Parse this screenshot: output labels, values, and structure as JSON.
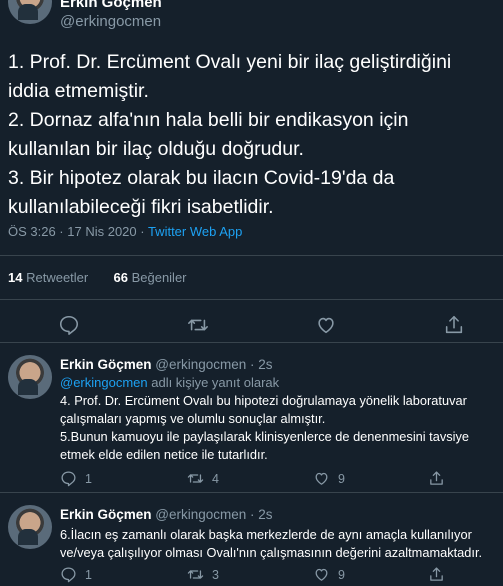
{
  "main_tweet": {
    "author_name": "Erkin Göçmen",
    "author_handle": "@erkingocmen",
    "text_lines": [
      "1. Prof. Dr. Ercüment Ovalı yeni bir ilaç geliştirdiğini iddia etmemiştir.",
      "2. Dornaz alfa'nın hala belli bir endikasyon için kullanılan bir ilaç olduğu doğrudur.",
      "3. Bir hipotez olarak bu ilacın Covid-19'da da kullanılabileceği fikri isabetlidir."
    ],
    "timestamp": "ÖS 3:26 · 17 Nis 2020 · ",
    "source": "Twitter Web App",
    "retweet_count": "14",
    "retweet_label": "Retweetler",
    "like_count": "66",
    "like_label": "Beğeniler"
  },
  "replies": [
    {
      "author_name": "Erkin Göçmen",
      "author_handle": "@erkingocmen · 2s",
      "reply_to_handle": "@erkingocmen",
      "reply_to_suffix": " adlı kişiye yanıt olarak",
      "text_lines": [
        "4. Prof. Dr. Ercüment Ovalı bu hipotezi doğrulamaya yönelik laboratuvar çalışmaları yapmış ve olumlu sonuçlar almıştır.",
        "5.Bunun kamuoyu ile paylaşılarak klinisyenlerce de denenmesini tavsiye etmek elde edilen netice ile tutarlıdır."
      ],
      "reply_count": "1",
      "retweet_count": "4",
      "like_count": "9"
    },
    {
      "author_name": "Erkin Göçmen",
      "author_handle": "@erkingocmen · 2s",
      "text_lines": [
        "6.İlacın eş zamanlı olarak başka merkezlerde de aynı amaçla kullanılıyor ve/veya çalışılıyor olması Ovalı'nın çalışmasının değerini azaltmamaktadır."
      ],
      "reply_count": "1",
      "retweet_count": "3",
      "like_count": "9"
    }
  ],
  "icons": {
    "reply": "reply-icon",
    "retweet": "retweet-icon",
    "like": "heart-icon",
    "share": "share-icon"
  },
  "colors": {
    "background": "#15202b",
    "accent": "#1da1f2",
    "muted": "#8899a6",
    "divider": "#38444d"
  }
}
